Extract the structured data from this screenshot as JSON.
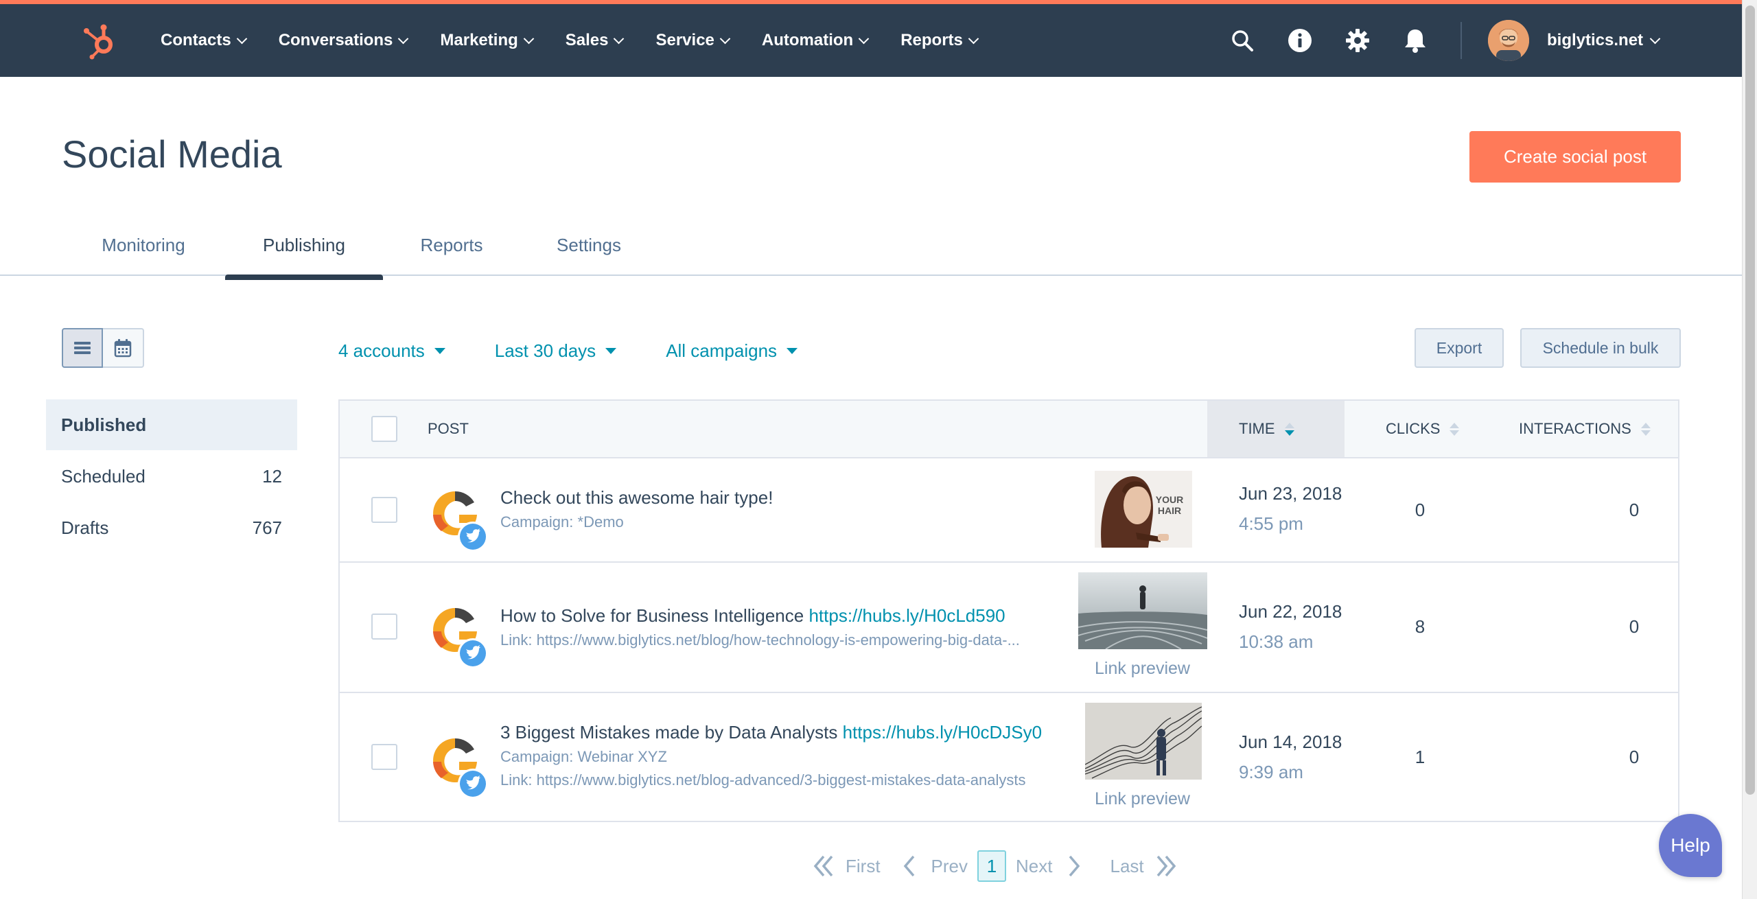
{
  "colors": {
    "nav_bg": "#2d3e50",
    "accent": "#ff7a59",
    "link": "#0091ae",
    "help": "#6a78d1"
  },
  "nav": {
    "logo_icon": "hubspot-sprocket-icon",
    "menu": [
      {
        "label": "Contacts"
      },
      {
        "label": "Conversations"
      },
      {
        "label": "Marketing"
      },
      {
        "label": "Sales"
      },
      {
        "label": "Service"
      },
      {
        "label": "Automation"
      },
      {
        "label": "Reports"
      }
    ],
    "icons": [
      "search-icon",
      "info-icon",
      "gear-icon",
      "bell-icon"
    ],
    "account": "biglytics.net"
  },
  "header": {
    "title": "Social Media",
    "create_label": "Create social post"
  },
  "tabs": [
    {
      "label": "Monitoring",
      "active": false
    },
    {
      "label": "Publishing",
      "active": true
    },
    {
      "label": "Reports",
      "active": false
    },
    {
      "label": "Settings",
      "active": false
    }
  ],
  "sidebar": {
    "items": [
      {
        "label": "Published",
        "count": "",
        "active": true
      },
      {
        "label": "Scheduled",
        "count": "12",
        "active": false
      },
      {
        "label": "Drafts",
        "count": "767",
        "active": false
      }
    ]
  },
  "filters": {
    "accounts": "4 accounts",
    "date_range": "Last 30 days",
    "campaigns": "All campaigns"
  },
  "actions": {
    "export": "Export",
    "schedule_bulk": "Schedule in bulk"
  },
  "table": {
    "headers": {
      "post": "POST",
      "time": "TIME",
      "clicks": "CLICKS",
      "interactions": "INTERACTIONS"
    },
    "rows": [
      {
        "text": "Check out this awesome hair type!",
        "link": "",
        "campaign": "Campaign: *Demo",
        "link_detail": "",
        "thumb_text": "YOUR HAIR",
        "preview_label": "",
        "date": "Jun 23, 2018",
        "time": "4:55 pm",
        "clicks": "0",
        "interactions": "0"
      },
      {
        "text": "How to Solve for Business Intelligence",
        "link": "https://hubs.ly/H0cLd590",
        "campaign": "",
        "link_detail": "Link: https://www.biglytics.net/blog/how-technology-is-empowering-big-data-...",
        "thumb_text": "",
        "preview_label": "Link preview",
        "date": "Jun 22, 2018",
        "time": "10:38 am",
        "clicks": "8",
        "interactions": "0"
      },
      {
        "text": "3 Biggest Mistakes made by Data Analysts",
        "link": "https://hubs.ly/H0cDJSy0",
        "campaign": "Campaign: Webinar XYZ",
        "link_detail": "Link: https://www.biglytics.net/blog-advanced/3-biggest-mistakes-data-analysts",
        "thumb_text": "",
        "preview_label": "Link preview",
        "date": "Jun 14, 2018",
        "time": "9:39 am",
        "clicks": "1",
        "interactions": "0"
      }
    ]
  },
  "pagination": {
    "first": "First",
    "prev": "Prev",
    "current": "1",
    "next": "Next",
    "last": "Last"
  },
  "help_label": "Help"
}
